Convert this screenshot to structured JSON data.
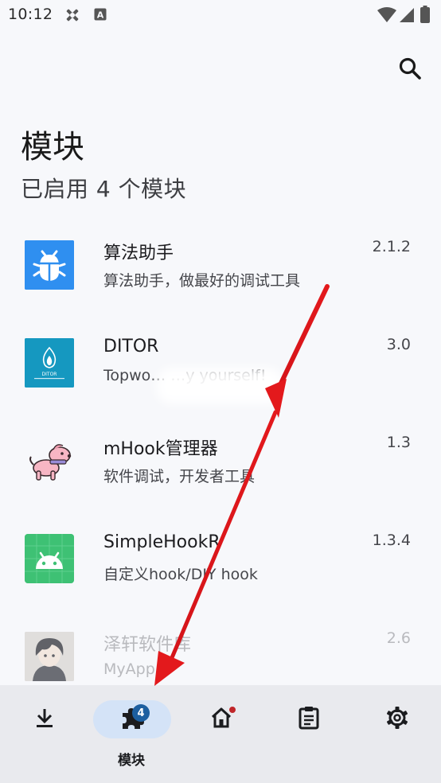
{
  "status_bar": {
    "time": "10:12",
    "icons": [
      "pinwheel-icon",
      "a-letter-icon",
      "wifi-icon",
      "signal-icon",
      "battery-icon"
    ]
  },
  "header": {
    "search_icon": "search-icon",
    "title": "模块",
    "subtitle": "已启用 4 个模块"
  },
  "modules": [
    {
      "name": "算法助手",
      "description": "算法助手，做最好的调试工具",
      "version": "2.1.2",
      "icon": "bug-icon",
      "icon_color": "#2f8ff0"
    },
    {
      "name": "DITOR",
      "description": "Topwo… …y yourself!",
      "version": "3.0",
      "icon": "ditor-flame-icon",
      "icon_color": "#1598c0"
    },
    {
      "name": "mHook管理器",
      "description": "软件调试，开发者工具",
      "version": "1.3",
      "icon": "pink-dog-icon",
      "icon_color": "#f7b6c4"
    },
    {
      "name": "SimpleHookR",
      "description": "自定义hook/DIY hook",
      "version": "1.3.4",
      "icon": "android-icon",
      "icon_color": "#3ec174"
    },
    {
      "name": "泽轩软件库",
      "description": "MyApp",
      "version": "2.6",
      "icon": "anime-avatar-icon",
      "icon_color": "#7a7d87"
    }
  ],
  "bottom_nav": {
    "items": [
      {
        "id": "download",
        "icon": "download-icon",
        "label": ""
      },
      {
        "id": "modules",
        "icon": "puzzle-icon",
        "label": "模块",
        "badge": "4",
        "active": true
      },
      {
        "id": "home",
        "icon": "home-icon",
        "label": "",
        "dot": true
      },
      {
        "id": "logs",
        "icon": "clipboard-icon",
        "label": ""
      },
      {
        "id": "settings",
        "icon": "gear-icon",
        "label": ""
      }
    ]
  },
  "annotation": {
    "arrow_color": "#e3191c"
  }
}
